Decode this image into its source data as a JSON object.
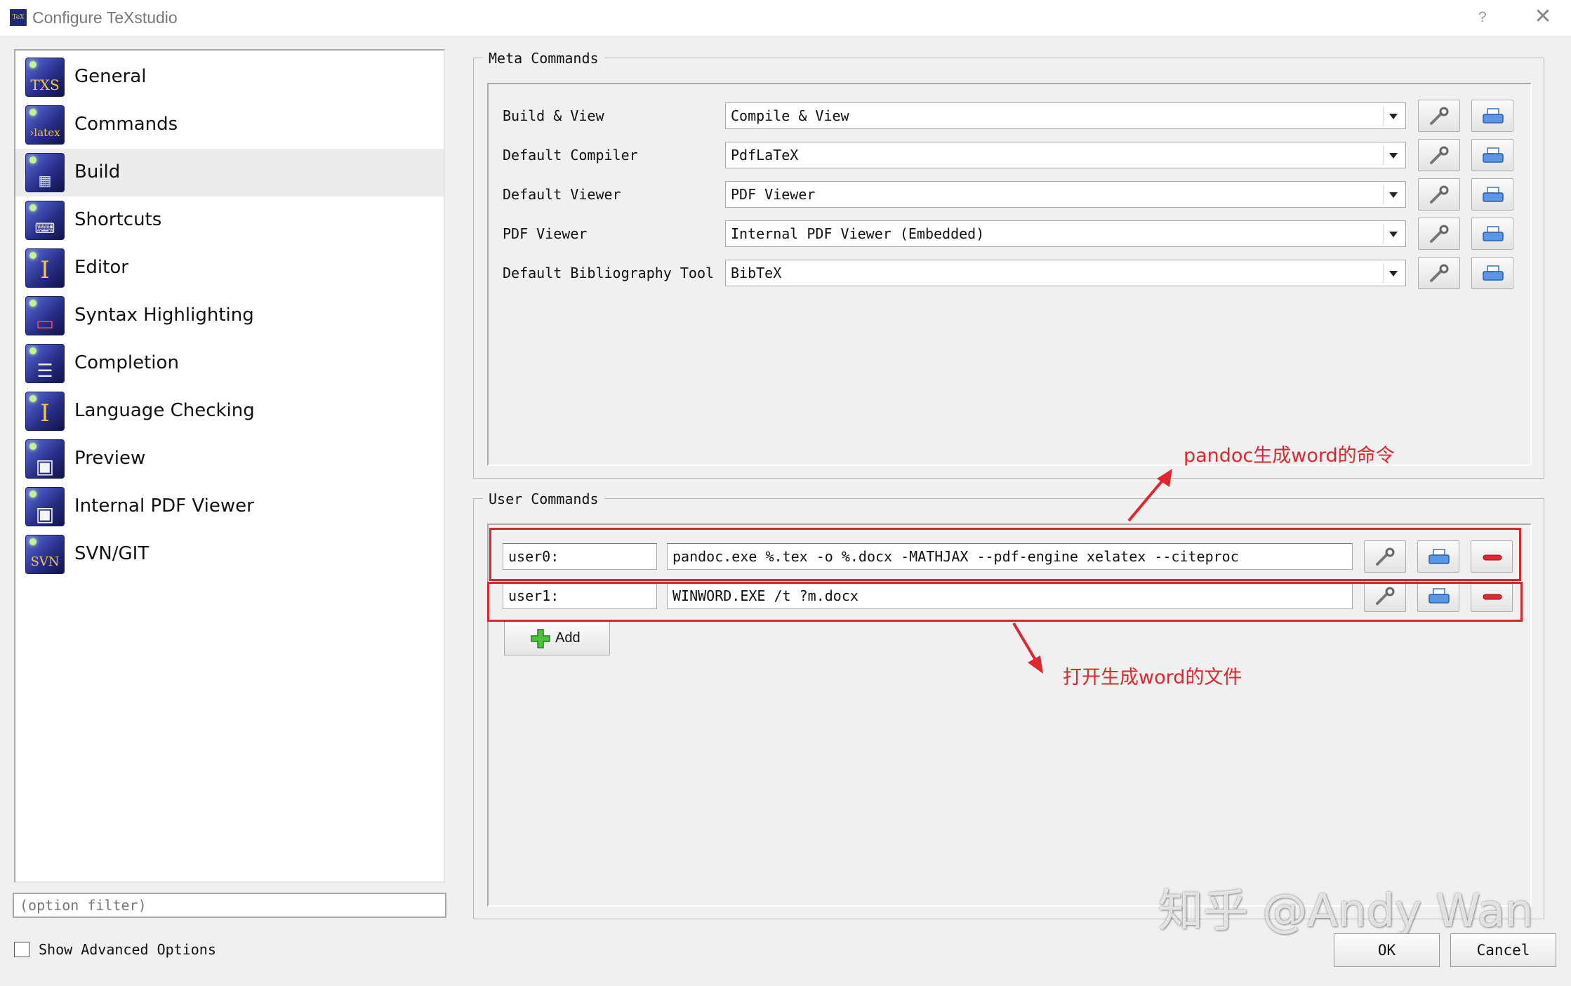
{
  "window": {
    "title": "Configure TeXstudio",
    "help_symbol": "?",
    "close_symbol": "✕"
  },
  "sidebar": {
    "items": [
      {
        "label": "General",
        "icon": "txs-icon",
        "glyph": "TXS"
      },
      {
        "label": "Commands",
        "icon": "latex-icon",
        "glyph": "›latex"
      },
      {
        "label": "Build",
        "icon": "build-icon",
        "glyph": "▦",
        "selected": true
      },
      {
        "label": "Shortcuts",
        "icon": "keyboard-icon",
        "glyph": "⌨"
      },
      {
        "label": "Editor",
        "icon": "text-cursor-icon",
        "glyph": "I"
      },
      {
        "label": "Syntax Highlighting",
        "icon": "highlight-icon",
        "glyph": "▭"
      },
      {
        "label": "Completion",
        "icon": "list-icon",
        "glyph": "☰"
      },
      {
        "label": "Language Checking",
        "icon": "text-cursor-icon",
        "glyph": "I"
      },
      {
        "label": "Preview",
        "icon": "preview-icon",
        "glyph": "▣"
      },
      {
        "label": "Internal PDF Viewer",
        "icon": "pdf-viewer-icon",
        "glyph": "▣"
      },
      {
        "label": "SVN/GIT",
        "icon": "svn-icon",
        "glyph": "SVN"
      }
    ],
    "filter_placeholder": "(option filter)",
    "show_advanced_label": "Show Advanced Options",
    "show_advanced_checked": false
  },
  "meta_commands": {
    "title": "Meta Commands",
    "rows": [
      {
        "label": "Build & View",
        "value": "Compile & View"
      },
      {
        "label": "Default Compiler",
        "value": "PdfLaTeX"
      },
      {
        "label": "Default Viewer",
        "value": "PDF Viewer"
      },
      {
        "label": "PDF Viewer",
        "value": "Internal PDF Viewer (Embedded)"
      },
      {
        "label": "Default Bibliography Tool",
        "value": "BibTeX"
      }
    ]
  },
  "user_commands": {
    "title": "User Commands",
    "rows": [
      {
        "name": "user0:",
        "command": "pandoc.exe %.tex -o %.docx -MATHJAX --pdf-engine xelatex  --citeproc"
      },
      {
        "name": "user1:",
        "command": "WINWORD.EXE /t ?m.docx"
      }
    ],
    "add_label": "Add"
  },
  "annotations": {
    "pandoc_note": "pandoc生成word的命令",
    "open_note": "打开生成word的文件",
    "color": "#e0262e"
  },
  "watermark": "知乎 @Andy Wan",
  "buttons": {
    "ok": "OK",
    "cancel": "Cancel"
  }
}
